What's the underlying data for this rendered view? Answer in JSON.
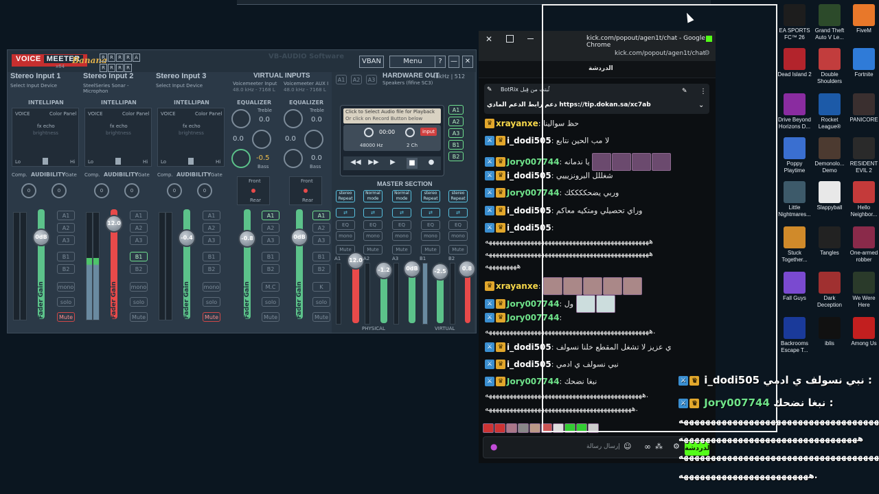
{
  "voicemeeter": {
    "logo": "VOICE",
    "logo2": "MEETER",
    "brand": "Banana",
    "x64": "x64",
    "rgrid": [
      "R",
      "R",
      "R",
      "R",
      "A",
      "R",
      "R",
      "R",
      "R"
    ],
    "aux_text": "VB-AUDIO Software",
    "vban": "VBAN",
    "menu": "Menu",
    "help": "?",
    "min": "—",
    "close": "✕",
    "strips": [
      {
        "title": "Stereo Input 1",
        "sub": "Select Input Device",
        "fader": "0dB",
        "routes": [
          "A1",
          "A2",
          "A3",
          "B1",
          "B2"
        ],
        "mono": "mono",
        "solo": "solo",
        "mute": "Mute",
        "mute_on": true,
        "b1_on": false,
        "red": false
      },
      {
        "title": "Stereo Input 2",
        "sub": "SteelSeries Sonar - Microphon",
        "fader": "12.0",
        "routes": [
          "A1",
          "A2",
          "A3",
          "B1",
          "B2"
        ],
        "mono": "mono",
        "solo": "solo",
        "mute": "Mute",
        "mute_on": false,
        "b1_on": true,
        "red": true
      },
      {
        "title": "Stereo Input 3",
        "sub": "Select Input Device",
        "fader": "-0.4",
        "routes": [
          "A1",
          "A2",
          "A3",
          "B1",
          "B2"
        ],
        "mono": "mono",
        "solo": "solo",
        "mute": "Mute",
        "mute_on": true,
        "b1_on": false,
        "red": false
      }
    ],
    "intellipan": "INTELLIPAN",
    "voice": "VOICE",
    "color_panel": "Color Panel",
    "fx_echo": "fx echo",
    "brightness": "brightness",
    "lo": "Lo",
    "hi": "Hi",
    "comp": "Comp.",
    "audibility": "AUDIBILITY",
    "gate": "Gate",
    "knob_zero": "0",
    "fader_gain": "Fader Gain",
    "virtual_inputs": "VIRTUAL INPUTS",
    "virtuals": [
      {
        "title": "Voicemeeter Input",
        "sub": "48.0 kHz - 7168 L",
        "eq_treble": "0.0",
        "eq_mid": "0.0",
        "eq_bass": "-0.5",
        "fader": "-0.8",
        "routes": [
          "A1",
          "A2",
          "A3",
          "B1",
          "B2"
        ],
        "m": "M.C",
        "solo": "solo",
        "mute": "Mute"
      },
      {
        "title": "Voicemeeter AUX I",
        "sub": "48.0 kHz - 7168 L",
        "eq_treble": "0.0",
        "eq_mid": "0.0",
        "eq_bass": "0.0",
        "fader": "0dB",
        "routes": [
          "A1",
          "A2",
          "A3",
          "B1",
          "B2"
        ],
        "m": "K",
        "solo": "solo",
        "mute": "Mute"
      }
    ],
    "equalizer": "EQUALIZER",
    "treble": "Treble",
    "bass": "Bass",
    "front": "Front",
    "rear": "Rear",
    "hw_out": "HARDWARE OUT",
    "hw_rate": "48kHz | 512",
    "hw_dev": "Speakers (fifine SC3)",
    "hw_buttons": [
      "A1",
      "A2",
      "A3"
    ],
    "player_text1": "Click to Select Audio file for Playback",
    "player_text2": "Or click on Record Button below",
    "player_time": "00:00",
    "player_input": "input",
    "player_rate": "48000 Hz",
    "player_ch": "2 Ch",
    "player_routes": [
      "A1",
      "A2",
      "A3",
      "B1",
      "B2"
    ],
    "master_section": "MASTER SECTION",
    "master_modes": [
      "stereo Repeat",
      "Normal mode",
      "Normal mode",
      "stereo Repeat",
      "stereo Repeat"
    ],
    "eq": "EQ",
    "mono": "mono",
    "mute": "Mute",
    "bus_labels": [
      "A1",
      "A2",
      "A3",
      "B1",
      "B2"
    ],
    "bus_values": [
      "12.0",
      "-1.2",
      "0dB",
      "-2.5",
      "0.8"
    ],
    "physical": "PHYSICAL",
    "virtual": "VIRTUAL"
  },
  "chrome": {
    "window_title": "kick.com/popout/agen1t/chat - Google Chrome",
    "url": "kick.com/popout/agen1t/chat",
    "chat_tab": "الدردشة",
    "pinned_by": "BotRix ثُبتت من قِبل",
    "pinned_text": "دعم رابط الدعم المادي https://tip.dokan.sa/xc7ab",
    "input_placeholder": "إرسال رسالة",
    "send": "الدردشة",
    "messages": [
      {
        "badges": [
          "gold"
        ],
        "user": "xrayanxe",
        "color": "yellow",
        "text": "حظ سوالينا"
      },
      {
        "badges": [
          "blue",
          "gold"
        ],
        "user": "i_dodi505",
        "color": "white",
        "text": "لا مب الحين نتابع"
      },
      {
        "badges": [
          "blue",
          "gold"
        ],
        "user": "Jory007744",
        "color": "green",
        "text": "يا ندمانه"
      },
      {
        "badges": [
          "blue",
          "gold"
        ],
        "user": "i_dodi505",
        "color": "white",
        "text": "شغللل البرونزيييي"
      },
      {
        "badges": [
          "blue",
          "gold"
        ],
        "user": "Jory007744",
        "color": "green",
        "text": "وربي يضحككككك"
      },
      {
        "badges": [
          "blue",
          "gold"
        ],
        "user": "i_dodi505",
        "color": "white",
        "text": "وراي تحصيلي ومتكيه معاكم"
      },
      {
        "badges": [
          "blue",
          "gold"
        ],
        "user": "i_dodi505",
        "color": "white",
        "text": ""
      },
      {
        "badges": [
          "gold"
        ],
        "user": "xrayanxe",
        "color": "yellow",
        "text": ""
      },
      {
        "badges": [
          "blue",
          "gold"
        ],
        "user": "Jory007744",
        "color": "green",
        "text": "ول"
      },
      {
        "badges": [
          "blue",
          "gold"
        ],
        "user": "Jory007744",
        "color": "green",
        "text": ""
      },
      {
        "badges": [
          "blue",
          "gold"
        ],
        "user": "i_dodi505",
        "color": "white",
        "text": "ي عزيز لا تشغل المقطع خلنا نسولف"
      },
      {
        "badges": [
          "blue",
          "gold"
        ],
        "user": "i_dodi505",
        "color": "white",
        "text": "نبي نسولف ي ادمي"
      },
      {
        "badges": [
          "blue",
          "gold"
        ],
        "user": "Jory007744",
        "color": "green",
        "text": "نبغا نضحك"
      }
    ],
    "long1": "هههههههههههههههههههههههههههههههههههههههههههههههه",
    "long1b": "هههههههههه",
    "long2": "هههههههههههههههههههههههههههههههههههههههههههههههه.",
    "long3": "هههههههههههههههههههههههههههههههههههههههههههههه.",
    "long3b": "ههههههههههههههههههههههههههههههههههههههههههه."
  },
  "desktop_icons": [
    {
      "label": "EA SPORTS FC™ 26",
      "color": "#1d1d1d"
    },
    {
      "label": "Grand Theft Auto V Le...",
      "color": "#2c4a2a"
    },
    {
      "label": "FiveM",
      "color": "#e8782a"
    },
    {
      "label": "Dead Island 2",
      "color": "#b3242c"
    },
    {
      "label": "Double Shoulders",
      "color": "#c23d3d"
    },
    {
      "label": "Fortnite",
      "color": "#2f7bd8"
    },
    {
      "label": "Drive Beyond Horizons D...",
      "color": "#8a2ca0"
    },
    {
      "label": "Rocket League®",
      "color": "#1c5aa8"
    },
    {
      "label": "PANICORE",
      "color": "#3a2f2f"
    },
    {
      "label": "Poppy Playtime",
      "color": "#3a6fd0"
    },
    {
      "label": "Demonolo... Demo",
      "color": "#4c3a30"
    },
    {
      "label": "RESIDENT EVIL 2",
      "color": "#2a2a2a"
    },
    {
      "label": "Little Nightmares...",
      "color": "#3d5a6a"
    },
    {
      "label": "Slappyball",
      "color": "#e8e8e8"
    },
    {
      "label": "Hello Neighbor...",
      "color": "#c43a3a"
    },
    {
      "label": "Stuck Together...",
      "color": "#d08a2a"
    },
    {
      "label": "Tangles",
      "color": "#222"
    },
    {
      "label": "One-armed robber",
      "color": "#8a2a4a"
    },
    {
      "label": "Fall Guys",
      "color": "#7a4ad0"
    },
    {
      "label": "Dark Deception",
      "color": "#a03030"
    },
    {
      "label": "We Were Here",
      "color": "#2a3a2a"
    },
    {
      "label": "Backrooms Escape T...",
      "color": "#1a3a9a"
    },
    {
      "label": "iblis",
      "color": "#111"
    },
    {
      "label": "Among Us",
      "color": "#c21f1f"
    }
  ],
  "overlay": {
    "line1_user": "i_dodi505",
    "line1_text": "نبي نسولف ي ادمي :",
    "line2_user": "Jory007744",
    "line2_text": "نبغا نضحك :",
    "long_a": "هههههههههههههههههههههههههههههههههههههه",
    "long_b": "هههههههههههههههههههههههههههههههههه",
    "long_c": "هههههههههههههههههههههههههههههههههههههه",
    "long_d": "ههههههههههههههههههههههههه."
  }
}
